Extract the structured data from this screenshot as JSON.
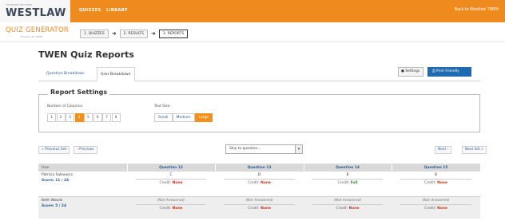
{
  "header": {
    "logo_sub": "THOMSON REUTERS",
    "logo": "WESTLAW",
    "nav": [
      "QUIZZES",
      "LIBRARY"
    ],
    "back_link": "Back to Westlaw TWEN"
  },
  "subbar": {
    "title": "QUIZ GENERATOR",
    "subtitle": "Powered by TWEN",
    "steps": [
      "1. QUIZZES",
      "2. RESULTS",
      "3. REPORTS"
    ],
    "active_step": 2
  },
  "page": {
    "title": "TWEN Quiz Reports",
    "tabs": [
      "Question Breakdown",
      "User Breakdown"
    ],
    "active_tab": 1,
    "settings_label": "Settings",
    "print_label": "Print Friendly"
  },
  "report_settings": {
    "legend": "Report Settings",
    "columns_label": "Number of Columns:",
    "columns": [
      "1",
      "2",
      "3",
      "4",
      "5",
      "6",
      "7",
      "8"
    ],
    "active_column": 3,
    "text_size_label": "Text Size:",
    "text_sizes": [
      "Small",
      "Medium",
      "Large"
    ],
    "active_text_size": 2
  },
  "pagination": {
    "prev_set": "« Previous Set",
    "prev": "‹ Previous",
    "skip_placeholder": "Skip to question...",
    "next": "Next ›",
    "next_set": "Next Set »"
  },
  "table": {
    "headers": [
      "User",
      "Question 12",
      "Question 13",
      "Question 14",
      "Question 15"
    ],
    "rows": [
      {
        "name": "Patricia Salkowicz",
        "score": "Score: 11 / 24",
        "cells": [
          {
            "answer": "C",
            "credit_label": "Credit:",
            "credit": "None"
          },
          {
            "answer": "D",
            "credit_label": "Credit:",
            "credit": "None"
          },
          {
            "answer": "B",
            "credit_label": "Credit:",
            "credit": "Full"
          },
          {
            "answer": "B",
            "credit_label": "Credit:",
            "credit": "None"
          }
        ]
      },
      {
        "name": "Beth Woods",
        "score": "Score: 5 / 24",
        "cells": [
          {
            "answer": "(Not Answered)",
            "credit_label": "Credit:",
            "credit": "None"
          },
          {
            "answer": "(Not Answered)",
            "credit_label": "Credit:",
            "credit": "None"
          },
          {
            "answer": "(Not Answered)",
            "credit_label": "Credit:",
            "credit": "None"
          },
          {
            "answer": "(Not Answered)",
            "credit_label": "Credit:",
            "credit": "None"
          }
        ]
      }
    ]
  },
  "colors": {
    "brand_orange": "#ef8a1f",
    "link_blue": "#2b5b93",
    "print_blue": "#1f6ab0",
    "credit_none": "#c43520",
    "credit_full": "#2e8b2e"
  }
}
